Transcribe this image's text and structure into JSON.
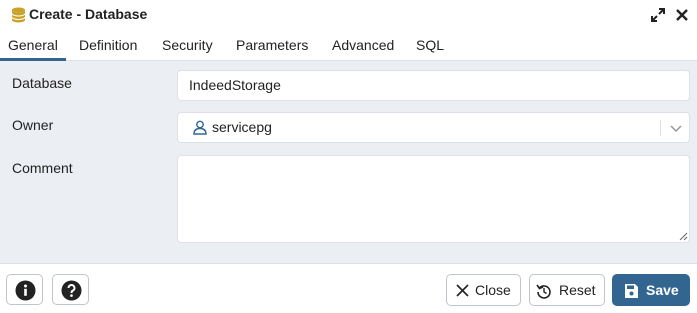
{
  "dialog": {
    "title": "Create - Database",
    "icon": "database-icon"
  },
  "tabs": [
    {
      "label": "General",
      "active": true
    },
    {
      "label": "Definition",
      "active": false
    },
    {
      "label": "Security",
      "active": false
    },
    {
      "label": "Parameters",
      "active": false
    },
    {
      "label": "Advanced",
      "active": false
    },
    {
      "label": "SQL",
      "active": false
    }
  ],
  "form": {
    "database": {
      "label": "Database",
      "value": "IndeedStorage"
    },
    "owner": {
      "label": "Owner",
      "value": "servicepg",
      "icon": "user-icon"
    },
    "comment": {
      "label": "Comment",
      "value": ""
    }
  },
  "footer": {
    "info_icon": "info-icon",
    "help_icon": "help-icon",
    "close_label": "Close",
    "reset_label": "Reset",
    "save_label": "Save"
  },
  "colors": {
    "accent": "#326690",
    "form_background": "#ebeef3",
    "border": "#dde0e6",
    "database_icon": "#c9a227"
  }
}
